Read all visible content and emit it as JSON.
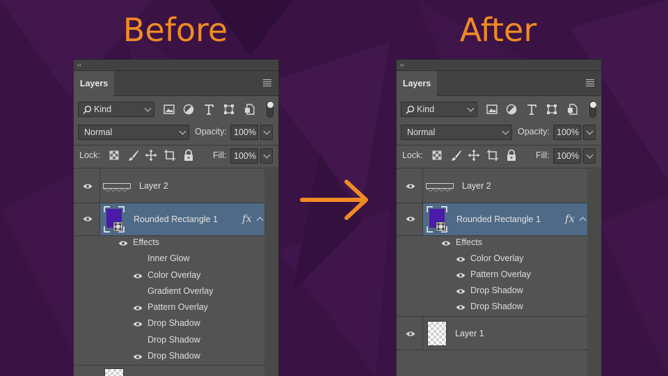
{
  "headings": {
    "before": "Before",
    "after": "After"
  },
  "colors": {
    "accent": "#f08a24",
    "selection": "#4e6a86",
    "shape_fill": "#4a1aa8"
  },
  "panel_common": {
    "collapse_glyph": "‹‹",
    "tab_label": "Layers",
    "kind_label": "Kind",
    "blend_mode": "Normal",
    "opacity_label": "Opacity:",
    "opacity_value": "100%",
    "lock_label": "Lock:",
    "fill_label": "Fill:",
    "fill_value": "100%",
    "fx_label": "fx"
  },
  "before": {
    "layers": [
      {
        "name": "Layer 2",
        "visible": true
      },
      {
        "name": "Rounded Rectangle 1",
        "visible": true,
        "selected": true
      }
    ],
    "effects_label": "Effects",
    "effects": [
      {
        "name": "Inner Glow",
        "visible": false
      },
      {
        "name": "Color Overlay",
        "visible": true
      },
      {
        "name": "Gradient Overlay",
        "visible": false
      },
      {
        "name": "Pattern Overlay",
        "visible": true
      },
      {
        "name": "Drop Shadow",
        "visible": true
      },
      {
        "name": "Drop Shadow",
        "visible": false
      },
      {
        "name": "Drop Shadow",
        "visible": true
      }
    ]
  },
  "after": {
    "layers": [
      {
        "name": "Layer 2",
        "visible": true
      },
      {
        "name": "Rounded Rectangle 1",
        "visible": true,
        "selected": true
      },
      {
        "name": "Layer 1",
        "visible": true
      }
    ],
    "effects_label": "Effects",
    "effects": [
      {
        "name": "Color Overlay",
        "visible": true
      },
      {
        "name": "Pattern Overlay",
        "visible": true
      },
      {
        "name": "Drop Shadow",
        "visible": true
      },
      {
        "name": "Drop Shadow",
        "visible": true
      }
    ]
  }
}
